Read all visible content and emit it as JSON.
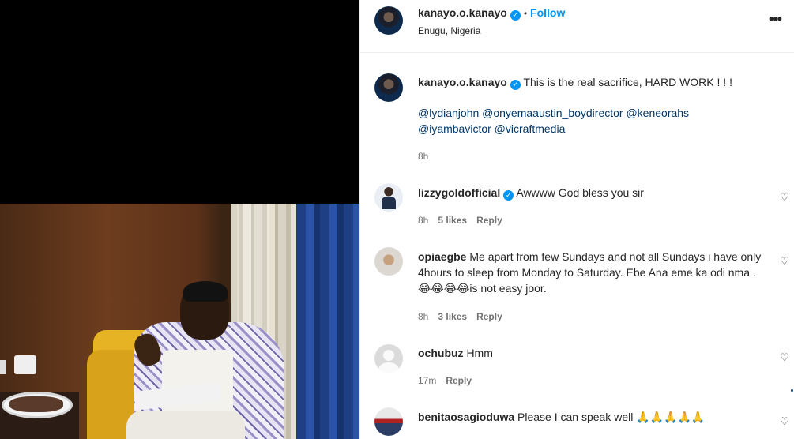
{
  "post": {
    "author": "kanayo.o.kanayo",
    "separator": "•",
    "follow_label": "Follow",
    "location": "Enugu, Nigeria",
    "more_label": "•••",
    "caption_text": "This is the real sacrifice, HARD WORK ! ! !",
    "mentions_line1": "@lydianjohn @onyemaaustin_boydirector @keneorahs",
    "mentions_line2": "@iyambavictor @vicraftmedia",
    "time": "8h"
  },
  "comments": [
    {
      "user": "lizzygoldofficial",
      "verified": true,
      "text": "Awwww God bless you sir",
      "time": "8h",
      "likes": "5 likes",
      "reply": "Reply"
    },
    {
      "user": "opiaegbe",
      "verified": false,
      "text": "Me apart from few Sundays and not all Sundays i have only 4hours to sleep from Monday to Saturday. Ebe Ana eme ka odi nma . 😂😂😂😂is not easy joor.",
      "time": "8h",
      "likes": "3 likes",
      "reply": "Reply"
    },
    {
      "user": "ochubuz",
      "verified": false,
      "text": "Hmm",
      "time": "17m",
      "likes": "",
      "reply": "Reply"
    },
    {
      "user": "benitaosagioduwa",
      "verified": false,
      "text": "Please I can speak well 🙏🙏🙏🙏🙏",
      "time": "",
      "likes": "",
      "reply": ""
    }
  ],
  "icons": {
    "verified": "verified-badge-icon",
    "heart": "heart-outline-icon",
    "more": "more-options-icon"
  },
  "colors": {
    "link_blue": "#0095f6",
    "mention_blue": "#00376b",
    "meta_gray": "#737373",
    "text": "#262626"
  }
}
